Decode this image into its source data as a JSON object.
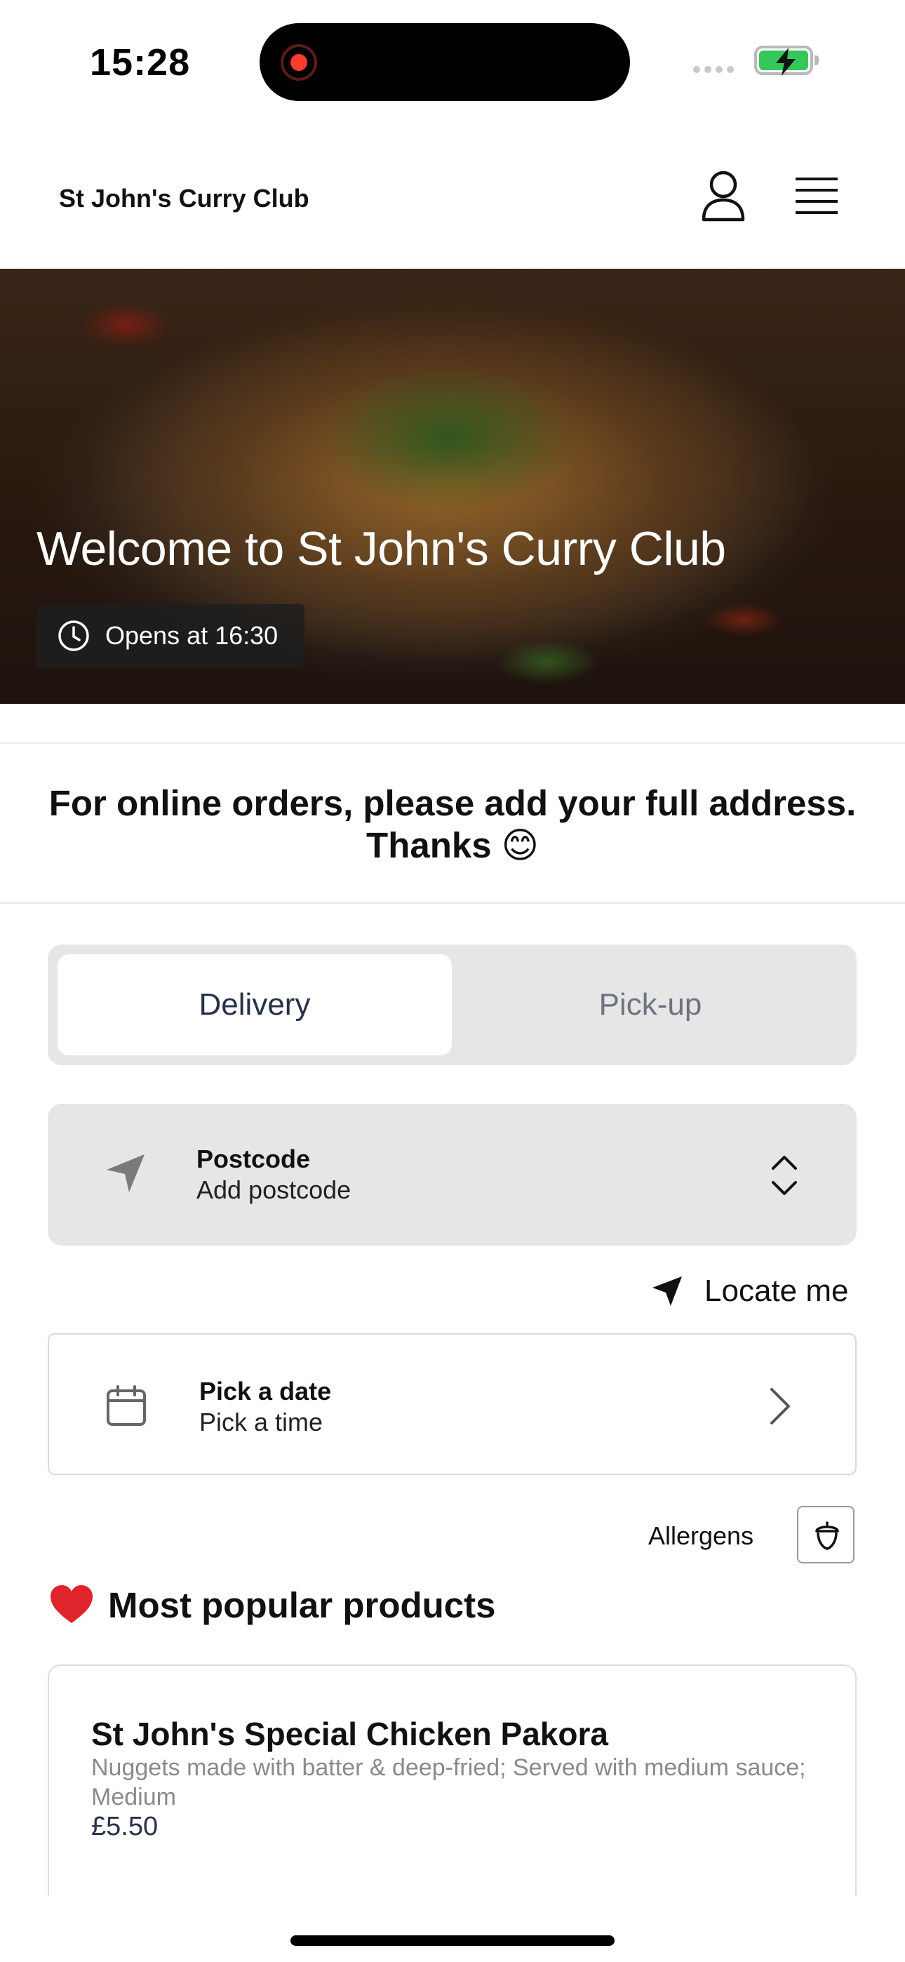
{
  "status_bar": {
    "time": "15:28"
  },
  "header": {
    "brand": "St John's Curry Club",
    "account_icon": "person-icon",
    "menu_icon": "hamburger-menu-icon"
  },
  "hero": {
    "title": "Welcome to St John's Curry Club",
    "hours": "Opens at 16:30",
    "hours_icon": "clock-icon"
  },
  "notice": {
    "text": "For online orders, please add your full address. Thanks 😊"
  },
  "order_type": {
    "tabs": [
      {
        "label": "Delivery",
        "selected": true
      },
      {
        "label": "Pick-up",
        "selected": false
      }
    ]
  },
  "postcode": {
    "label": "Postcode",
    "value": "Add postcode",
    "icon": "navigation-arrow-icon"
  },
  "locate": {
    "label": "Locate me"
  },
  "schedule": {
    "label": "Pick a date",
    "value": "Pick a time",
    "icon": "calendar-icon"
  },
  "allergens": {
    "label": "Allergens",
    "icon": "acorn-icon"
  },
  "popular": {
    "title": "Most popular products",
    "products": [
      {
        "name": "St John's Special Chicken Pakora",
        "description": "Nuggets made with batter & deep-fried; Served with medium sauce; Medium",
        "price": "£5.50"
      }
    ]
  },
  "colors": {
    "accent_text": "#27314a",
    "tab_background": "#e6e6e6",
    "battery_green": "#34c759",
    "recording_red": "#ff3b30"
  }
}
